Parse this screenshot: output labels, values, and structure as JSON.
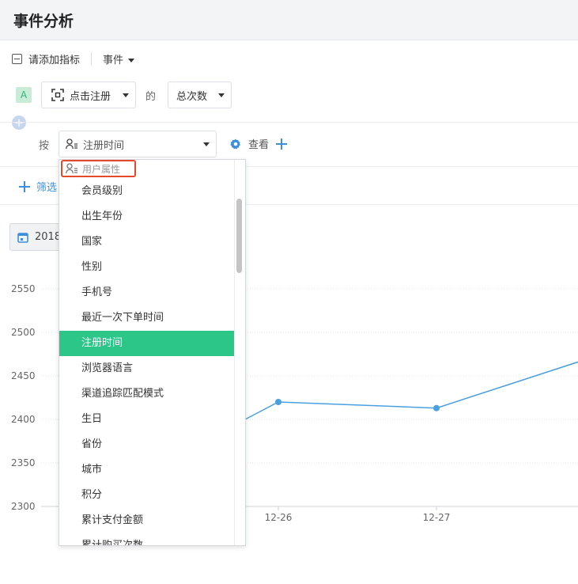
{
  "header": {
    "title": "事件分析"
  },
  "metric_row": {
    "add_metric_label": "请添加指标",
    "type_selector": "事件"
  },
  "metric": {
    "letter": "A",
    "event": "点击注册",
    "of": "的",
    "aggregation": "总次数"
  },
  "group_by": {
    "label": "按",
    "property": "注册时间",
    "view_label": "查看"
  },
  "filter": {
    "label": "筛选"
  },
  "date": {
    "label": "2018"
  },
  "dropdown": {
    "group_label": "用户属性",
    "items": [
      "会员级别",
      "出生年份",
      "国家",
      "性别",
      "手机号",
      "最近一次下单时间",
      "注册时间",
      "浏览器语言",
      "渠道追踪匹配模式",
      "生日",
      "省份",
      "城市",
      "积分",
      "累计支付金额",
      "累计购买次数"
    ],
    "selected_index": 6
  },
  "chart_data": {
    "type": "line",
    "y_ticks": [
      "2550",
      "2500",
      "2450",
      "2400",
      "2350",
      "2300"
    ],
    "x_labels": [
      "12-26",
      "12-27"
    ],
    "ylim": [
      2300,
      2550
    ],
    "series": [
      {
        "values": [
          2400,
          2420,
          2413,
          2466
        ],
        "x": [
          "",
          "12-26",
          "12-27",
          ""
        ]
      }
    ],
    "color": "#4a9fe0",
    "grid": true
  },
  "colors": {
    "accent": "#2bc688",
    "link": "#3d8fdc",
    "highlight_border": "#e5492c"
  }
}
